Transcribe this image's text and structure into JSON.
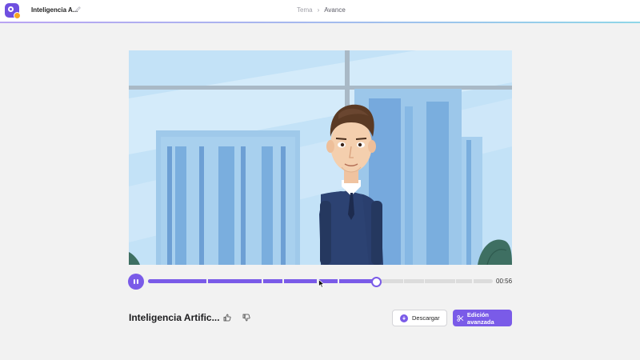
{
  "header": {
    "project_title": "Inteligencia A...",
    "breadcrumb": {
      "parent": "Tema",
      "separator": "›",
      "current": "Avance"
    }
  },
  "player": {
    "state": "playing",
    "time_label": "00:56",
    "progress": 0.66,
    "segment_marks": [
      0.17,
      0.33,
      0.39,
      0.49,
      0.55,
      0.66,
      0.74,
      0.8,
      0.89,
      0.94
    ]
  },
  "video": {
    "title": "Inteligencia Artific..."
  },
  "actions": {
    "download_label": "Descargar",
    "advanced_edit_label": "Edición avanzada"
  },
  "colors": {
    "accent": "#7a5be8",
    "sky": "#bfe0f6",
    "suit": "#2a3f6e",
    "background": "#f2f2f2"
  },
  "icons": {
    "like": "thumbs-up-icon",
    "dislike": "thumbs-down-icon",
    "download": "download-icon",
    "scissors": "scissors-icon",
    "edit": "pencil-icon"
  }
}
